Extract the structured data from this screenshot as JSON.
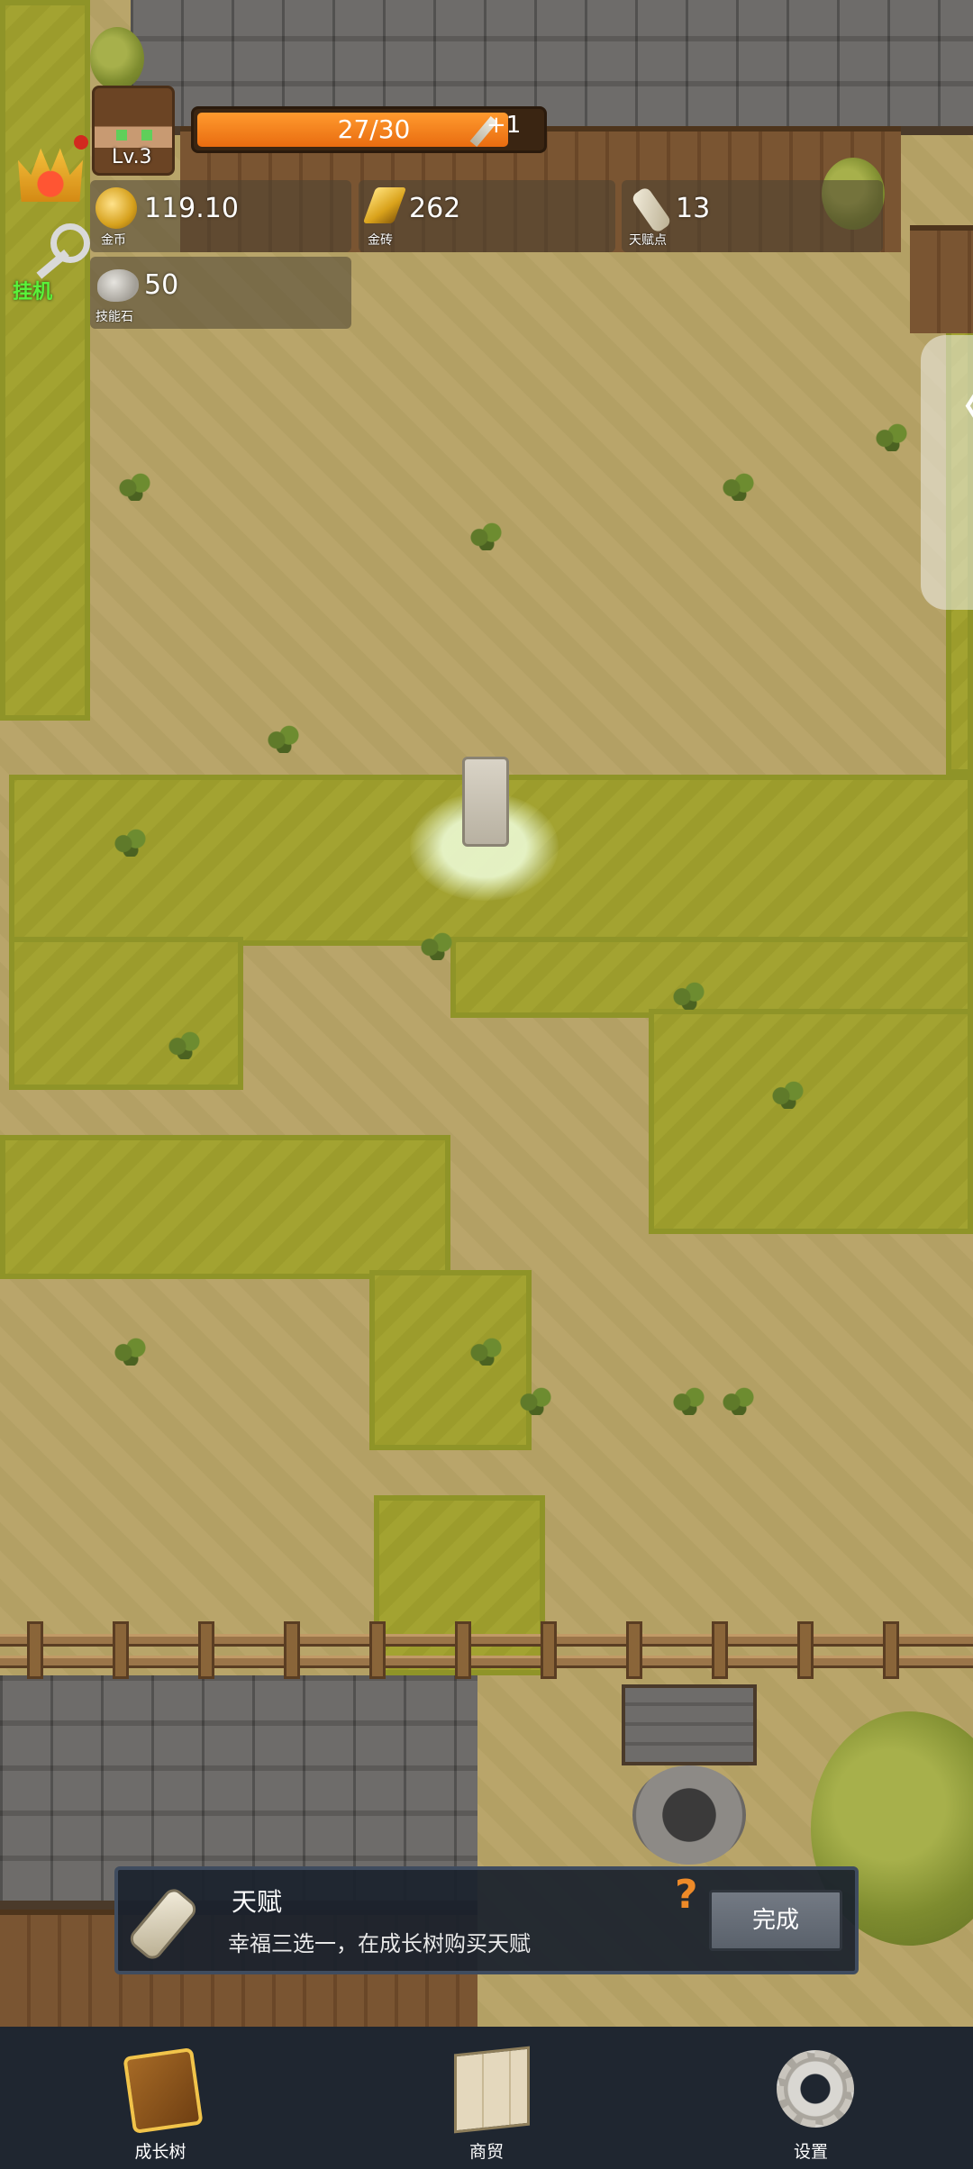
{
  "player": {
    "level": "Lv.3",
    "energy": "27/30",
    "energy_current": 27,
    "energy_max": 30,
    "energy_regen": "+1"
  },
  "hud": {
    "auto_label": "挂机"
  },
  "resources": [
    {
      "icon": "gold-coin-icon",
      "value": "119.10",
      "label": "金币"
    },
    {
      "icon": "gold-brick-icon",
      "value": "262",
      "label": "金砖"
    },
    {
      "icon": "talent-scroll-icon",
      "value": "13",
      "label": "天赋点"
    },
    {
      "icon": "skill-stone-icon",
      "value": "50",
      "label": "技能石"
    }
  ],
  "quest": {
    "title": "天赋",
    "description": "幸福三选一，在成长树购买天赋",
    "help": "?",
    "button": "完成"
  },
  "side_handle": {
    "glyph": "〈"
  },
  "nav": [
    {
      "label": "成长树",
      "icon": "growth-tree-book-icon"
    },
    {
      "label": "商贸",
      "icon": "trade-map-icon"
    },
    {
      "label": "设置",
      "icon": "settings-gear-icon"
    }
  ],
  "colors": {
    "energy_bar": "#e96c10",
    "auto_label": "#59f23a",
    "quest_help": "#ee8a28",
    "nav_background": "#1f2630"
  }
}
